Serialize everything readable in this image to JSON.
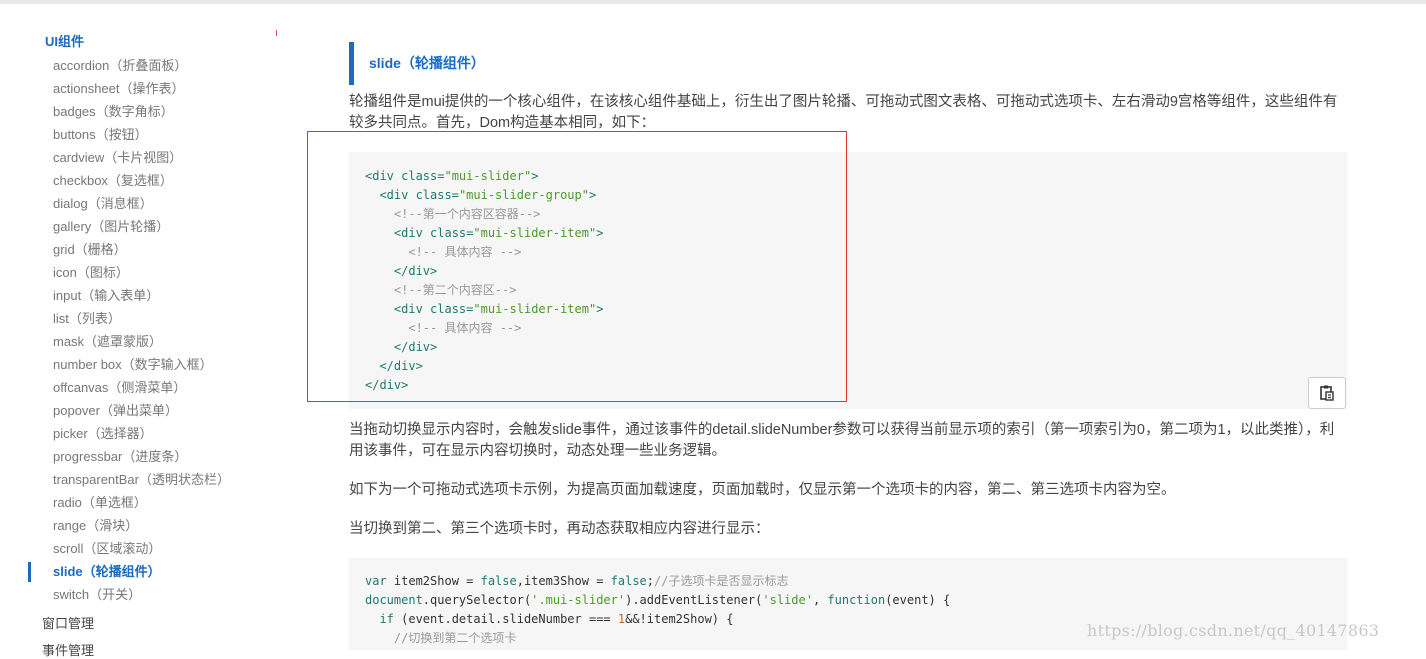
{
  "sidebar": {
    "section_title": "UI组件",
    "items": [
      {
        "label": "accordion（折叠面板）",
        "active": false
      },
      {
        "label": "actionsheet（操作表）",
        "active": false
      },
      {
        "label": "badges（数字角标）",
        "active": false
      },
      {
        "label": "buttons（按钮）",
        "active": false
      },
      {
        "label": "cardview（卡片视图）",
        "active": false
      },
      {
        "label": "checkbox（复选框）",
        "active": false
      },
      {
        "label": "dialog（消息框）",
        "active": false
      },
      {
        "label": "gallery（图片轮播）",
        "active": false
      },
      {
        "label": "grid（栅格）",
        "active": false
      },
      {
        "label": "icon（图标）",
        "active": false
      },
      {
        "label": "input（输入表单）",
        "active": false
      },
      {
        "label": "list（列表）",
        "active": false
      },
      {
        "label": "mask（遮罩蒙版）",
        "active": false
      },
      {
        "label": "number box（数字输入框）",
        "active": false
      },
      {
        "label": "offcanvas（侧滑菜单）",
        "active": false
      },
      {
        "label": "popover（弹出菜单）",
        "active": false
      },
      {
        "label": "picker（选择器）",
        "active": false
      },
      {
        "label": "progressbar（进度条）",
        "active": false
      },
      {
        "label": "transparentBar（透明状态栏）",
        "active": false
      },
      {
        "label": "radio（单选框）",
        "active": false
      },
      {
        "label": "range（滑块）",
        "active": false
      },
      {
        "label": "scroll（区域滚动）",
        "active": false
      },
      {
        "label": "slide（轮播组件）",
        "active": true
      },
      {
        "label": "switch（开关）",
        "active": false
      }
    ],
    "window_section": "窗口管理",
    "event_section": "事件管理"
  },
  "main": {
    "title": "slide（轮播组件）",
    "intro": "轮播组件是mui提供的一个核心组件，在该核心组件基础上，衍生出了图片轮播、可拖动式图文表格、可拖动式选项卡、左右滑动9宫格等组件，这些组件有较多共同点。首先，Dom构造基本相同，如下：",
    "para_slide_event": "当拖动切换显示内容时，会触发slide事件，通过该事件的detail.slideNumber参数可以获得当前显示项的索引（第一项索引为0，第二项为1，以此类推），利用该事件，可在显示内容切换时，动态处理一些业务逻辑。",
    "para_example": "如下为一个可拖动式选项卡示例，为提高页面加载速度，页面加载时，仅显示第一个选项卡的内容，第二、第三选项卡内容为空。",
    "para_switch": "当切换到第二、第三个选项卡时，再动态获取相应内容进行显示：",
    "copy_icon": "clipboard-icon"
  },
  "code1": {
    "lines": [
      [
        {
          "t": "<div ",
          "c": "kw"
        },
        {
          "t": "class=",
          "c": "kw"
        },
        {
          "t": "\"mui-slider\"",
          "c": "str"
        },
        {
          "t": ">",
          "c": "kw"
        }
      ],
      [
        {
          "t": "  <div ",
          "c": "kw"
        },
        {
          "t": "class=",
          "c": "kw"
        },
        {
          "t": "\"mui-slider-group\"",
          "c": "str"
        },
        {
          "t": ">",
          "c": "kw"
        }
      ],
      [
        {
          "t": "    <!--第一个内容区容器-->",
          "c": "cm"
        }
      ],
      [
        {
          "t": "    <div ",
          "c": "kw"
        },
        {
          "t": "class=",
          "c": "kw"
        },
        {
          "t": "\"mui-slider-item\"",
          "c": "str"
        },
        {
          "t": ">",
          "c": "kw"
        }
      ],
      [
        {
          "t": "      <!-- 具体内容 -->",
          "c": "cm"
        }
      ],
      [
        {
          "t": "    </div>",
          "c": "kw"
        }
      ],
      [
        {
          "t": "    <!--第二个内容区-->",
          "c": "cm"
        }
      ],
      [
        {
          "t": "    <div ",
          "c": "kw"
        },
        {
          "t": "class=",
          "c": "kw"
        },
        {
          "t": "\"mui-slider-item\"",
          "c": "str"
        },
        {
          "t": ">",
          "c": "kw"
        }
      ],
      [
        {
          "t": "      <!-- 具体内容 -->",
          "c": "cm"
        }
      ],
      [
        {
          "t": "    </div>",
          "c": "kw"
        }
      ],
      [
        {
          "t": "  </div>",
          "c": "kw"
        }
      ],
      [
        {
          "t": "</div>",
          "c": "kw"
        }
      ]
    ]
  },
  "code2": {
    "lines": [
      [
        {
          "t": "var ",
          "c": "kw"
        },
        {
          "t": "item2Show = ",
          "c": ""
        },
        {
          "t": "false",
          "c": "kw"
        },
        {
          "t": ",item3Show = ",
          "c": ""
        },
        {
          "t": "false",
          "c": "kw"
        },
        {
          "t": ";",
          "c": ""
        },
        {
          "t": "//子选项卡是否显示标志",
          "c": "cm"
        }
      ],
      [
        {
          "t": "document",
          "c": "kw"
        },
        {
          "t": ".querySelector(",
          "c": ""
        },
        {
          "t": "'.mui-slider'",
          "c": "str"
        },
        {
          "t": ").addEventListener(",
          "c": ""
        },
        {
          "t": "'slide'",
          "c": "str"
        },
        {
          "t": ", ",
          "c": ""
        },
        {
          "t": "function",
          "c": "kw"
        },
        {
          "t": "(event) {",
          "c": ""
        }
      ],
      [
        {
          "t": "  ",
          "c": ""
        },
        {
          "t": "if",
          "c": "kw"
        },
        {
          "t": " (event.detail.slideNumber === ",
          "c": ""
        },
        {
          "t": "1",
          "c": "num"
        },
        {
          "t": "&&!item2Show) {",
          "c": ""
        }
      ],
      [
        {
          "t": "    //切换到第二个选项卡",
          "c": "cm"
        }
      ]
    ]
  },
  "watermark": "https://blog.csdn.net/qq_40147863"
}
